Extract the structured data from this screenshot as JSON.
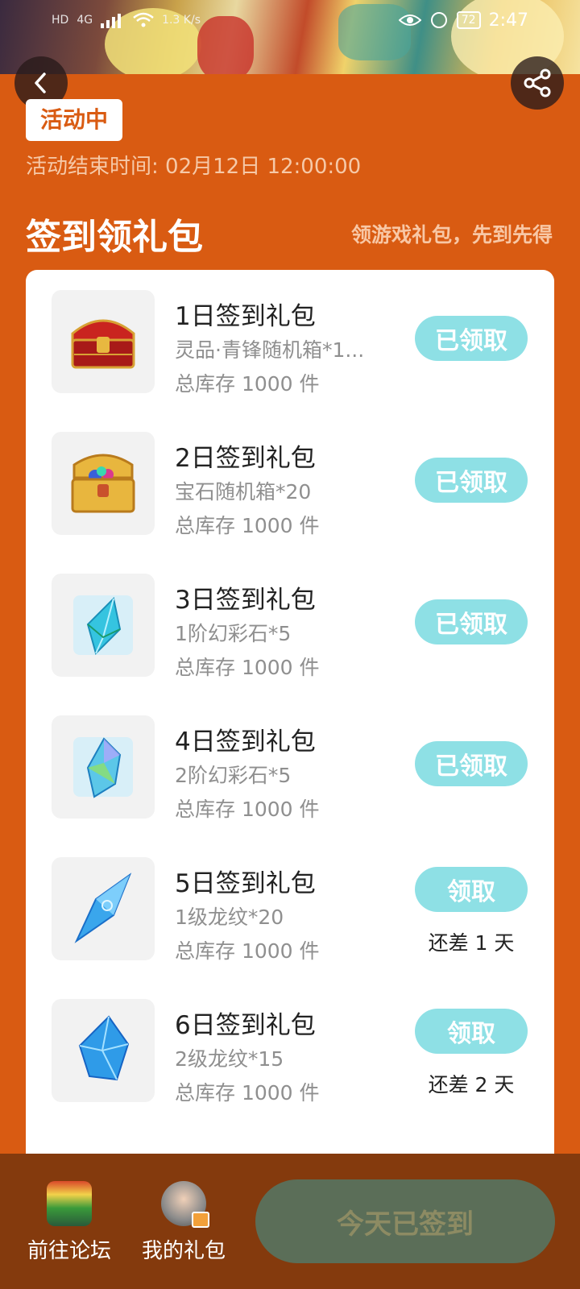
{
  "status_bar": {
    "left_items": [
      "HD",
      "4G",
      "1.3 K/s"
    ],
    "battery": "72",
    "time": "2:47"
  },
  "header": {
    "back_icon": "chevron-left-icon",
    "share_icon": "share-icon"
  },
  "activity": {
    "badge": "活动中",
    "end_time": "活动结束时间: 02月12日 12:00:00",
    "title": "签到领礼包",
    "subtitle": "领游戏礼包，先到先得"
  },
  "gifts": [
    {
      "name": "1日签到礼包",
      "desc": "灵品·青锋随机箱*1...",
      "stock": "总库存 1000 件",
      "button": "已领取",
      "remain": "",
      "icon": "red-chest-icon"
    },
    {
      "name": "2日签到礼包",
      "desc": "宝石随机箱*20",
      "stock": "总库存 1000 件",
      "button": "已领取",
      "remain": "",
      "icon": "gold-chest-icon"
    },
    {
      "name": "3日签到礼包",
      "desc": "1阶幻彩石*5",
      "stock": "总库存 1000 件",
      "button": "已领取",
      "remain": "",
      "icon": "crystal-icon"
    },
    {
      "name": "4日签到礼包",
      "desc": "2阶幻彩石*5",
      "stock": "总库存 1000 件",
      "button": "已领取",
      "remain": "",
      "icon": "rainbow-crystal-icon"
    },
    {
      "name": "5日签到礼包",
      "desc": "1级龙纹*20",
      "stock": "总库存 1000 件",
      "button": "领取",
      "remain": "还差 1 天",
      "icon": "blue-shard-icon"
    },
    {
      "name": "6日签到礼包",
      "desc": "2级龙纹*15",
      "stock": "总库存 1000 件",
      "button": "领取",
      "remain": "还差 2 天",
      "icon": "blue-gem-icon"
    }
  ],
  "bottom": {
    "forum_label": "前往论坛",
    "mygift_label": "我的礼包",
    "sign_button": "今天已签到"
  },
  "colors": {
    "page_bg": "#d95b12",
    "claim_button": "#8ee0e5",
    "bottom_bar": "#843a0d",
    "sign_button_bg": "#5b6e58"
  }
}
